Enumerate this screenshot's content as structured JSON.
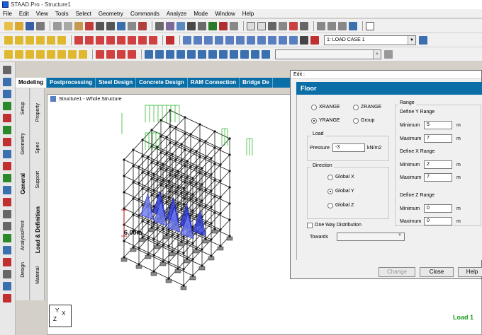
{
  "window": {
    "title": "STAAD.Pro - Structure1"
  },
  "menu": [
    "File",
    "Edit",
    "View",
    "Tools",
    "Select",
    "Geometry",
    "Commands",
    "Analyze",
    "Mode",
    "Window",
    "Help"
  ],
  "toolbar": {
    "load_case": "1: LOAD CASE 1",
    "load_case_secondary": ""
  },
  "page_tabs": [
    "Modeling",
    "Postprocessing",
    "Steel Design",
    "Concrete Design",
    "RAM Connection",
    "Bridge De"
  ],
  "vertical_tabs_main": [
    "Setup",
    "Geometry",
    "General",
    "Analysis/Print",
    "Design"
  ],
  "vertical_tabs_sub": [
    "Property",
    "Spec",
    "Support",
    "Load & Definition",
    "Material"
  ],
  "viewport": {
    "title": "Structure1 - Whole Structure",
    "dimension_label": "6.00m",
    "axis_labels": {
      "y": "Y",
      "z": "Z",
      "x": "X"
    },
    "load_label": "Load 1"
  },
  "dialog": {
    "title": "Edit :",
    "heading": "Floor",
    "range_options": [
      "XRANGE",
      "ZRANGE",
      "YRANGE",
      "Group"
    ],
    "selected_range": "YRANGE",
    "load_group": "Load",
    "pressure_label": "Pressure",
    "pressure_value": "-3",
    "pressure_unit": "kN/m2",
    "direction_group": "Direction",
    "directions": [
      "Global X",
      "Global Y",
      "Global Z"
    ],
    "selected_direction": "Global Y",
    "range_group": "Range",
    "y_range": {
      "label": "Define Y Range",
      "min_label": "Minimum",
      "min": "5",
      "max_label": "Maximum",
      "max": "7",
      "unit": "m"
    },
    "x_range": {
      "label": "Define X Range",
      "min_label": "Minimum",
      "min": "2",
      "max_label": "Maximum",
      "max": "7",
      "unit": "m"
    },
    "z_range": {
      "label": "Define Z Range",
      "min_label": "Minimum",
      "min": "0",
      "max_label": "Maximum",
      "max": "0",
      "unit": "m"
    },
    "one_way_label": "One Way Distribution",
    "towards_label": "Towards",
    "towards_value": "",
    "buttons": {
      "change": "Change",
      "close": "Close",
      "help": "Help"
    }
  }
}
